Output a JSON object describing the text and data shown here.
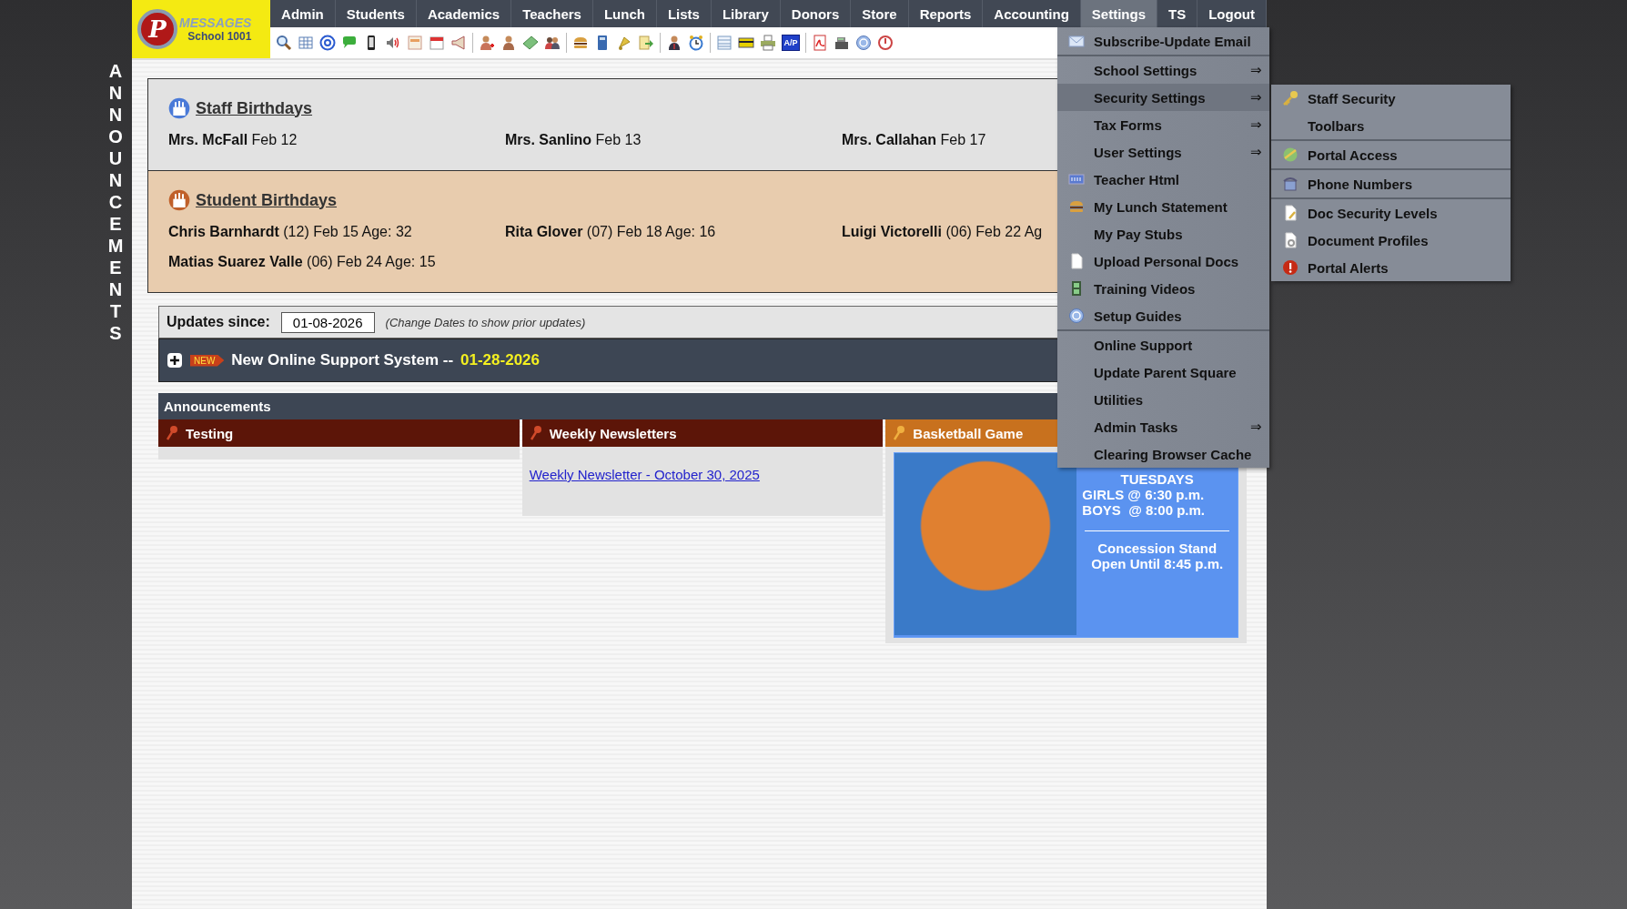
{
  "side_label": "ANNOUNCEMENTS",
  "logo": {
    "letter": "P",
    "name": "MESSAGES",
    "school": "School 1001"
  },
  "nav": [
    {
      "label": "Admin",
      "selected": false
    },
    {
      "label": "Students",
      "selected": false
    },
    {
      "label": "Academics",
      "selected": false
    },
    {
      "label": "Teachers",
      "selected": false
    },
    {
      "label": "Lunch",
      "selected": false
    },
    {
      "label": "Lists",
      "selected": false
    },
    {
      "label": "Library",
      "selected": false
    },
    {
      "label": "Donors",
      "selected": false
    },
    {
      "label": "Store",
      "selected": false
    },
    {
      "label": "Reports",
      "selected": false
    },
    {
      "label": "Accounting",
      "selected": false
    },
    {
      "label": "Settings",
      "selected": true
    },
    {
      "label": "TS",
      "selected": false
    },
    {
      "label": "Logout",
      "selected": false
    }
  ],
  "toolbar": {
    "ap_label": "A/P"
  },
  "staff_birthdays": {
    "title": "Staff Birthdays",
    "people": [
      {
        "name": "Mrs. McFall",
        "detail": "Feb 12"
      },
      {
        "name": "Mrs. Sanlino",
        "detail": "Feb 13"
      },
      {
        "name": "Mrs. Callahan",
        "detail": "Feb 17"
      }
    ]
  },
  "student_birthdays": {
    "title": "Student Birthdays",
    "people": [
      {
        "name": "Chris Barnhardt",
        "detail": "(12) Feb 15 Age: 32"
      },
      {
        "name": "Rita Glover",
        "detail": "(07) Feb 18 Age: 16"
      },
      {
        "name": "Luigi Victorelli",
        "detail": "(06) Feb 22 Ag"
      },
      {
        "name": "Matias Suarez Valle",
        "detail": "(06) Feb 24 Age: 15"
      }
    ]
  },
  "updates": {
    "label": "Updates since:",
    "date": "01-08-2026",
    "hint": "(Change Dates to show prior updates)"
  },
  "news": {
    "badge": "NEW",
    "title": "New Online Support System --",
    "date": "01-28-2026"
  },
  "announcements": {
    "title": "Announcements",
    "columns": [
      {
        "title": "Testing",
        "kind": "empty"
      },
      {
        "title": "Weekly Newsletters",
        "kind": "link",
        "link": "Weekly Newsletter - October 30, 2025"
      },
      {
        "title": "Basketball Game",
        "kind": "poster",
        "lines": [
          "TUESDAYS",
          "GIRLS @ 6:30 p.m.",
          "BOYS  @ 8:00 p.m."
        ],
        "lines_after_rule": [
          "Concession Stand",
          "Open Until 8:45 p.m."
        ]
      }
    ]
  },
  "settings_menu": [
    {
      "label": "Subscribe-Update Email",
      "selected": false,
      "separator_after": true
    },
    {
      "label": "School Settings",
      "arrow": "⇒",
      "selected": false
    },
    {
      "label": "Security Settings",
      "arrow": "⇒",
      "selected": true
    },
    {
      "label": "Tax Forms",
      "arrow": "⇒",
      "selected": false
    },
    {
      "label": "User Settings",
      "arrow": "⇒",
      "selected": false
    },
    {
      "label": "Teacher Html",
      "selected": false
    },
    {
      "label": "My Lunch Statement",
      "selected": false
    },
    {
      "label": "My Pay Stubs",
      "selected": false
    },
    {
      "label": "Upload Personal Docs",
      "selected": false
    },
    {
      "label": "Training Videos",
      "selected": false
    },
    {
      "label": "Setup Guides",
      "selected": false,
      "separator_after": true
    },
    {
      "label": "Online Support",
      "selected": false
    },
    {
      "label": "Update Parent Square",
      "selected": false
    },
    {
      "label": "Utilities",
      "selected": false
    },
    {
      "label": "Admin Tasks",
      "arrow": "⇒",
      "selected": false
    },
    {
      "label": "Clearing Browser Cache",
      "selected": false
    }
  ],
  "security_submenu": [
    {
      "label": "Staff Security"
    },
    {
      "label": "Toolbars",
      "separator_after": true
    },
    {
      "label": "Portal Access",
      "separator_after": true
    },
    {
      "label": "Phone Numbers",
      "separator_after": true
    },
    {
      "label": "Doc Security Levels"
    },
    {
      "label": "Document Profiles"
    },
    {
      "label": "Portal Alerts"
    }
  ]
}
